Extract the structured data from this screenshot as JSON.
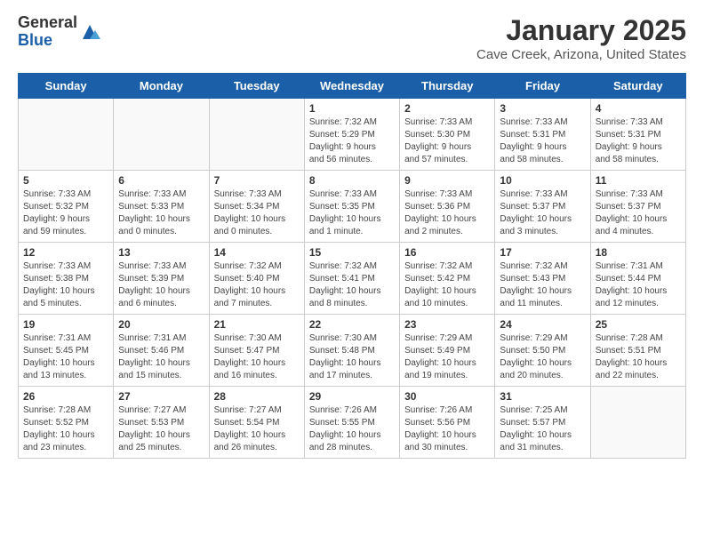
{
  "header": {
    "logo_general": "General",
    "logo_blue": "Blue",
    "title": "January 2025",
    "subtitle": "Cave Creek, Arizona, United States"
  },
  "days_of_week": [
    "Sunday",
    "Monday",
    "Tuesday",
    "Wednesday",
    "Thursday",
    "Friday",
    "Saturday"
  ],
  "weeks": [
    [
      {
        "day": "",
        "info": ""
      },
      {
        "day": "",
        "info": ""
      },
      {
        "day": "",
        "info": ""
      },
      {
        "day": "1",
        "info": "Sunrise: 7:32 AM\nSunset: 5:29 PM\nDaylight: 9 hours\nand 56 minutes."
      },
      {
        "day": "2",
        "info": "Sunrise: 7:33 AM\nSunset: 5:30 PM\nDaylight: 9 hours\nand 57 minutes."
      },
      {
        "day": "3",
        "info": "Sunrise: 7:33 AM\nSunset: 5:31 PM\nDaylight: 9 hours\nand 58 minutes."
      },
      {
        "day": "4",
        "info": "Sunrise: 7:33 AM\nSunset: 5:31 PM\nDaylight: 9 hours\nand 58 minutes."
      }
    ],
    [
      {
        "day": "5",
        "info": "Sunrise: 7:33 AM\nSunset: 5:32 PM\nDaylight: 9 hours\nand 59 minutes."
      },
      {
        "day": "6",
        "info": "Sunrise: 7:33 AM\nSunset: 5:33 PM\nDaylight: 10 hours\nand 0 minutes."
      },
      {
        "day": "7",
        "info": "Sunrise: 7:33 AM\nSunset: 5:34 PM\nDaylight: 10 hours\nand 0 minutes."
      },
      {
        "day": "8",
        "info": "Sunrise: 7:33 AM\nSunset: 5:35 PM\nDaylight: 10 hours\nand 1 minute."
      },
      {
        "day": "9",
        "info": "Sunrise: 7:33 AM\nSunset: 5:36 PM\nDaylight: 10 hours\nand 2 minutes."
      },
      {
        "day": "10",
        "info": "Sunrise: 7:33 AM\nSunset: 5:37 PM\nDaylight: 10 hours\nand 3 minutes."
      },
      {
        "day": "11",
        "info": "Sunrise: 7:33 AM\nSunset: 5:37 PM\nDaylight: 10 hours\nand 4 minutes."
      }
    ],
    [
      {
        "day": "12",
        "info": "Sunrise: 7:33 AM\nSunset: 5:38 PM\nDaylight: 10 hours\nand 5 minutes."
      },
      {
        "day": "13",
        "info": "Sunrise: 7:33 AM\nSunset: 5:39 PM\nDaylight: 10 hours\nand 6 minutes."
      },
      {
        "day": "14",
        "info": "Sunrise: 7:32 AM\nSunset: 5:40 PM\nDaylight: 10 hours\nand 7 minutes."
      },
      {
        "day": "15",
        "info": "Sunrise: 7:32 AM\nSunset: 5:41 PM\nDaylight: 10 hours\nand 8 minutes."
      },
      {
        "day": "16",
        "info": "Sunrise: 7:32 AM\nSunset: 5:42 PM\nDaylight: 10 hours\nand 10 minutes."
      },
      {
        "day": "17",
        "info": "Sunrise: 7:32 AM\nSunset: 5:43 PM\nDaylight: 10 hours\nand 11 minutes."
      },
      {
        "day": "18",
        "info": "Sunrise: 7:31 AM\nSunset: 5:44 PM\nDaylight: 10 hours\nand 12 minutes."
      }
    ],
    [
      {
        "day": "19",
        "info": "Sunrise: 7:31 AM\nSunset: 5:45 PM\nDaylight: 10 hours\nand 13 minutes."
      },
      {
        "day": "20",
        "info": "Sunrise: 7:31 AM\nSunset: 5:46 PM\nDaylight: 10 hours\nand 15 minutes."
      },
      {
        "day": "21",
        "info": "Sunrise: 7:30 AM\nSunset: 5:47 PM\nDaylight: 10 hours\nand 16 minutes."
      },
      {
        "day": "22",
        "info": "Sunrise: 7:30 AM\nSunset: 5:48 PM\nDaylight: 10 hours\nand 17 minutes."
      },
      {
        "day": "23",
        "info": "Sunrise: 7:29 AM\nSunset: 5:49 PM\nDaylight: 10 hours\nand 19 minutes."
      },
      {
        "day": "24",
        "info": "Sunrise: 7:29 AM\nSunset: 5:50 PM\nDaylight: 10 hours\nand 20 minutes."
      },
      {
        "day": "25",
        "info": "Sunrise: 7:28 AM\nSunset: 5:51 PM\nDaylight: 10 hours\nand 22 minutes."
      }
    ],
    [
      {
        "day": "26",
        "info": "Sunrise: 7:28 AM\nSunset: 5:52 PM\nDaylight: 10 hours\nand 23 minutes."
      },
      {
        "day": "27",
        "info": "Sunrise: 7:27 AM\nSunset: 5:53 PM\nDaylight: 10 hours\nand 25 minutes."
      },
      {
        "day": "28",
        "info": "Sunrise: 7:27 AM\nSunset: 5:54 PM\nDaylight: 10 hours\nand 26 minutes."
      },
      {
        "day": "29",
        "info": "Sunrise: 7:26 AM\nSunset: 5:55 PM\nDaylight: 10 hours\nand 28 minutes."
      },
      {
        "day": "30",
        "info": "Sunrise: 7:26 AM\nSunset: 5:56 PM\nDaylight: 10 hours\nand 30 minutes."
      },
      {
        "day": "31",
        "info": "Sunrise: 7:25 AM\nSunset: 5:57 PM\nDaylight: 10 hours\nand 31 minutes."
      },
      {
        "day": "",
        "info": ""
      }
    ]
  ]
}
